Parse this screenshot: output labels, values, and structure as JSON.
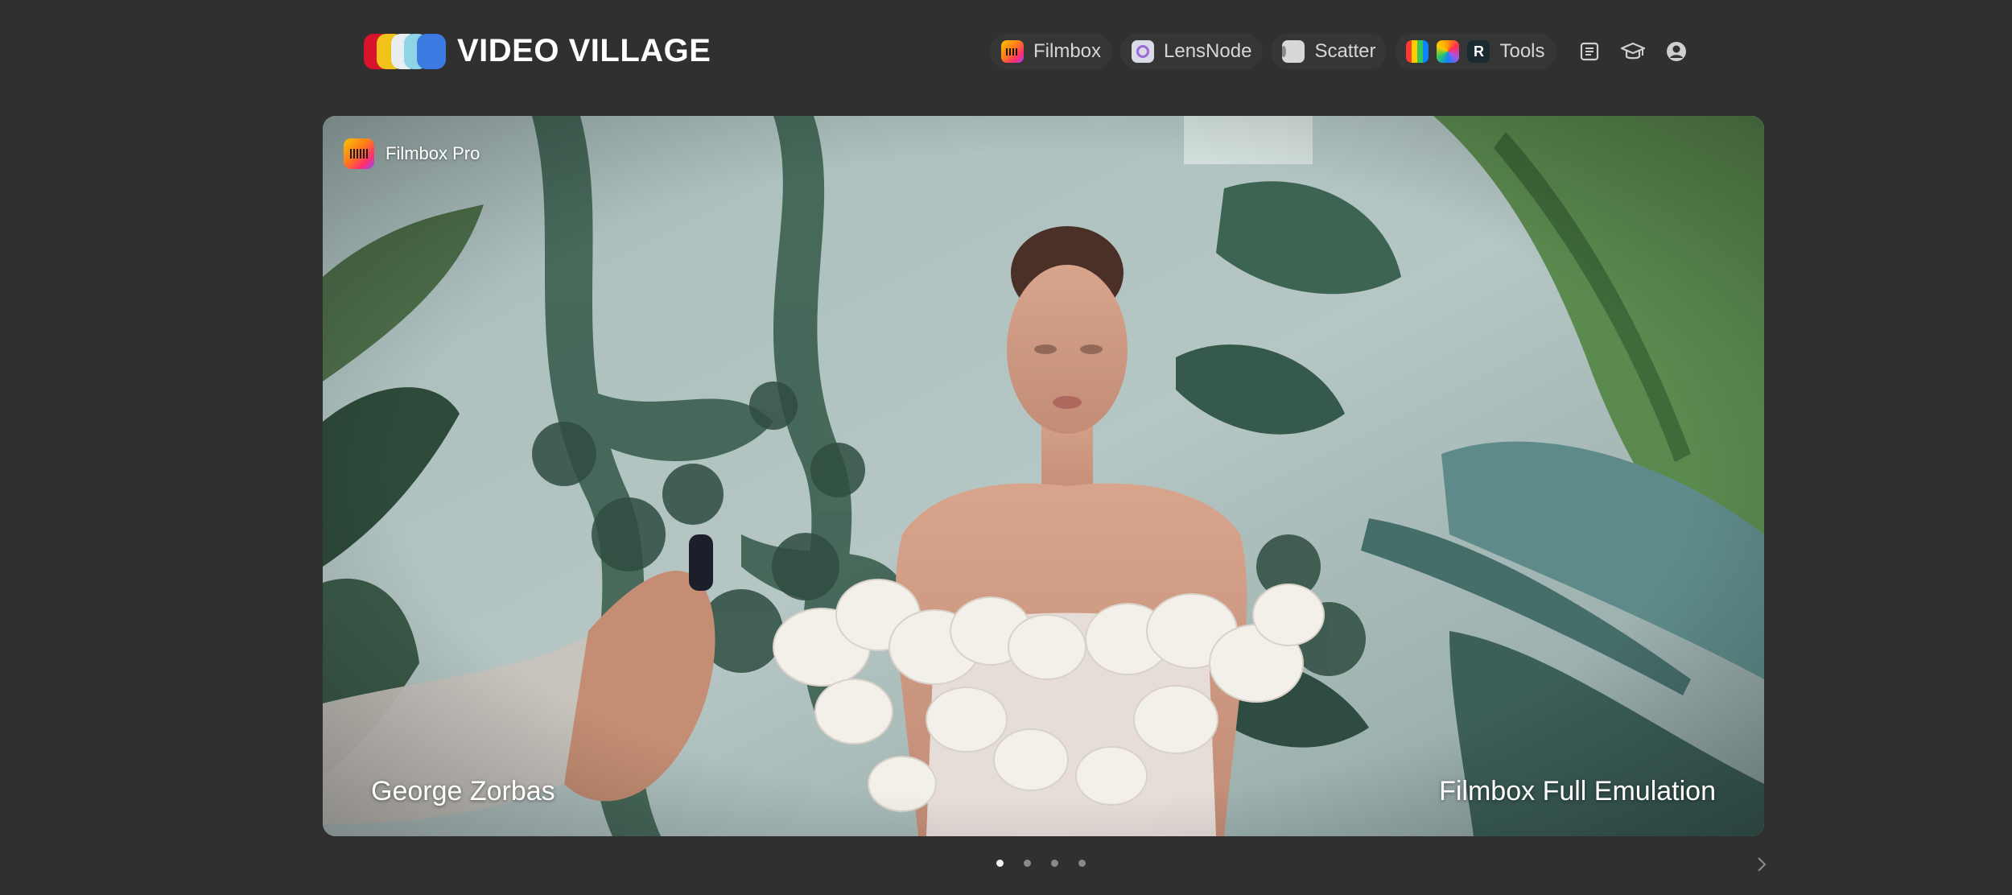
{
  "brand": {
    "name": "VIDEO VILLAGE",
    "colors": [
      "#d8142c",
      "#f1c31a",
      "#e9eef0",
      "#8ed3e6",
      "#3b7be2"
    ]
  },
  "nav": {
    "items": [
      {
        "label": "Filmbox",
        "icons": [
          "filmbox-icon"
        ]
      },
      {
        "label": "LensNode",
        "icons": [
          "lensnode-icon"
        ]
      },
      {
        "label": "Scatter",
        "icons": [
          "scatter-icon"
        ]
      },
      {
        "label": "Tools",
        "icons": [
          "color-bars-icon",
          "color-wheel-icon",
          "r-app-icon"
        ]
      }
    ],
    "utility_icons": [
      "news-icon",
      "graduation-cap-icon",
      "user-account-icon"
    ]
  },
  "hero": {
    "badge": {
      "icon": "filmbox-icon",
      "label": "Filmbox Pro"
    },
    "caption_left": "George Zorbas",
    "caption_right": "Filmbox Full Emulation"
  },
  "carousel": {
    "total_slides": 4,
    "active_index": 0,
    "next_icon": "chevron-right-icon"
  }
}
